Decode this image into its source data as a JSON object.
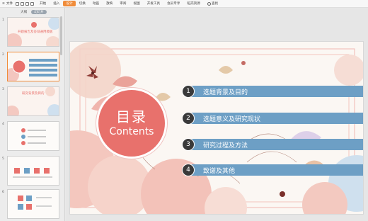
{
  "menubar": {
    "file_label": "文件",
    "tabs": [
      "开始",
      "插入",
      "设计",
      "切换",
      "动画",
      "放映",
      "审阅",
      "视图",
      "开发工具",
      "会员专享",
      "稻壳资源"
    ],
    "active_tab": "设计",
    "search_label": "查找"
  },
  "panel": {
    "outline_label": "大纲",
    "slides_label": "幻灯片",
    "thumbnails": [
      {
        "num": "1",
        "title": "开题报告及答辩通用模板"
      },
      {
        "num": "2",
        "title": "目录"
      },
      {
        "num": "3",
        "title": "研究背景及目的"
      },
      {
        "num": "4",
        "title": ""
      },
      {
        "num": "5",
        "title": ""
      },
      {
        "num": "6",
        "title": ""
      }
    ]
  },
  "slide": {
    "title_cn": "目录",
    "title_en": "Contents",
    "items": [
      {
        "num": "1",
        "label": "选题背景及目的"
      },
      {
        "num": "2",
        "label": "选题意义及研究现状"
      },
      {
        "num": "3",
        "label": "研究过程及方法"
      },
      {
        "num": "4",
        "label": "致谢及其他"
      }
    ]
  },
  "colors": {
    "accent": "#f08c3a",
    "circle": "#e8716c",
    "bar": "#6d9fc5",
    "badge": "#3a3a3a"
  }
}
